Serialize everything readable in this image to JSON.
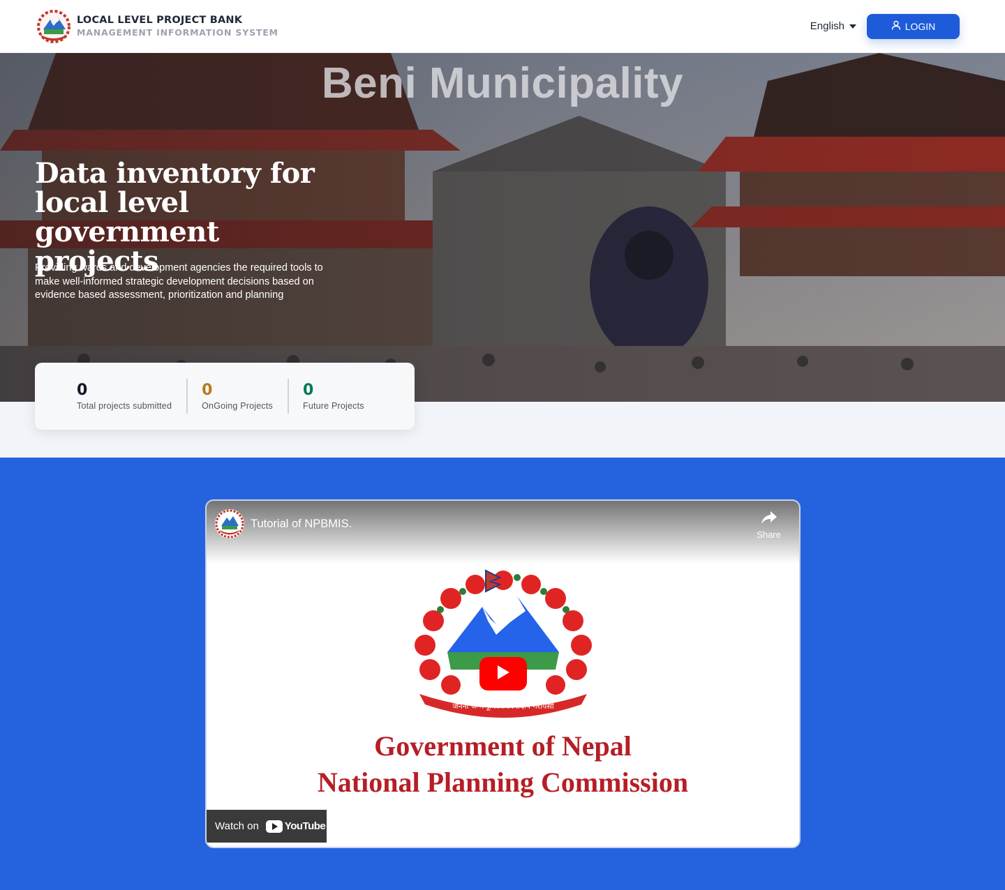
{
  "header": {
    "brand_title": "LOCAL LEVEL PROJECT BANK",
    "brand_subtitle": "MANAGEMENT INFORMATION SYSTEM",
    "language": "English",
    "login_label": "LOGIN"
  },
  "hero": {
    "municipality": "Beni Municipality",
    "heading": "Data inventory for local level government projects",
    "description": "Providing wards and development agencies the required tools to make well-informed strategic development decisions based on evidence based assessment, prioritization and planning"
  },
  "stats": [
    {
      "value": "0",
      "label": "Total projects submitted",
      "color": "#111827"
    },
    {
      "value": "0",
      "label": "OnGoing Projects",
      "color": "#b7791f"
    },
    {
      "value": "0",
      "label": "Future Projects",
      "color": "#047857"
    }
  ],
  "video": {
    "title": "Tutorial of NPBMIS.",
    "share_label": "Share",
    "watch_on": "Watch on",
    "youtube": "YouTube",
    "line1": "Government of Nepal",
    "line2": "National Planning Commission",
    "motto": "जननी जन्मभूमिश्च स्वर्गादपि गरीयसी"
  },
  "colors": {
    "accent": "#1d5bd8",
    "section_blue": "#2563de"
  }
}
